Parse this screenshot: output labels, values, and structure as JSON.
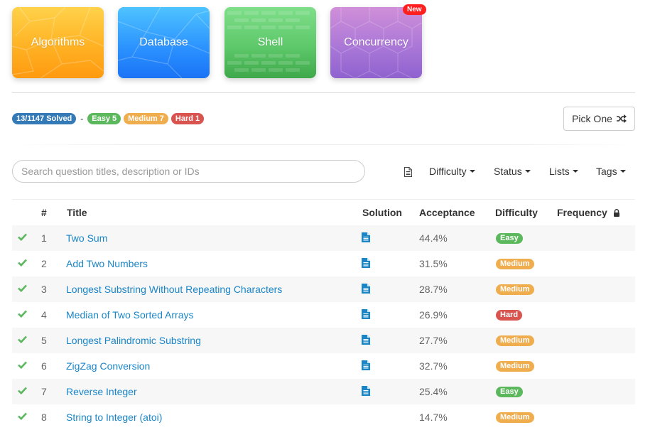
{
  "cards": [
    {
      "label": "Algorithms",
      "key": "alg"
    },
    {
      "label": "Database",
      "key": "db"
    },
    {
      "label": "Shell",
      "key": "sh"
    },
    {
      "label": "Concurrency",
      "key": "cc"
    }
  ],
  "new_badge": "New",
  "stats": {
    "solved": "13/1147 Solved",
    "separator": "-",
    "easy": "Easy 5",
    "medium": "Medium 7",
    "hard": "Hard 1"
  },
  "pick_one": {
    "label": "Pick One",
    "icon": "shuffle-icon"
  },
  "search": {
    "placeholder": "Search question titles, description or IDs",
    "value": ""
  },
  "filters": {
    "notes_icon": "document-icon",
    "difficulty": "Difficulty",
    "status": "Status",
    "lists": "Lists",
    "tags": "Tags"
  },
  "table": {
    "headers": {
      "num": "#",
      "title": "Title",
      "solution": "Solution",
      "acceptance": "Acceptance",
      "difficulty": "Difficulty",
      "frequency": "Frequency"
    },
    "rows": [
      {
        "num": "1",
        "title": "Two Sum",
        "solution": true,
        "acceptance": "44.4%",
        "difficulty": "Easy"
      },
      {
        "num": "2",
        "title": "Add Two Numbers",
        "solution": true,
        "acceptance": "31.5%",
        "difficulty": "Medium"
      },
      {
        "num": "3",
        "title": "Longest Substring Without Repeating Characters",
        "solution": true,
        "acceptance": "28.7%",
        "difficulty": "Medium"
      },
      {
        "num": "4",
        "title": "Median of Two Sorted Arrays",
        "solution": true,
        "acceptance": "26.9%",
        "difficulty": "Hard"
      },
      {
        "num": "5",
        "title": "Longest Palindromic Substring",
        "solution": true,
        "acceptance": "27.7%",
        "difficulty": "Medium"
      },
      {
        "num": "6",
        "title": "ZigZag Conversion",
        "solution": true,
        "acceptance": "32.7%",
        "difficulty": "Medium"
      },
      {
        "num": "7",
        "title": "Reverse Integer",
        "solution": true,
        "acceptance": "25.4%",
        "difficulty": "Easy"
      },
      {
        "num": "8",
        "title": "String to Integer (atoi)",
        "solution": false,
        "acceptance": "14.7%",
        "difficulty": "Medium"
      }
    ]
  },
  "colors": {
    "easy": "#5cb85c",
    "medium": "#f0ad4e",
    "hard": "#d9534f",
    "link": "#1a86c8",
    "check": "#5cb85c",
    "solution_icon": "#1a86c8"
  }
}
